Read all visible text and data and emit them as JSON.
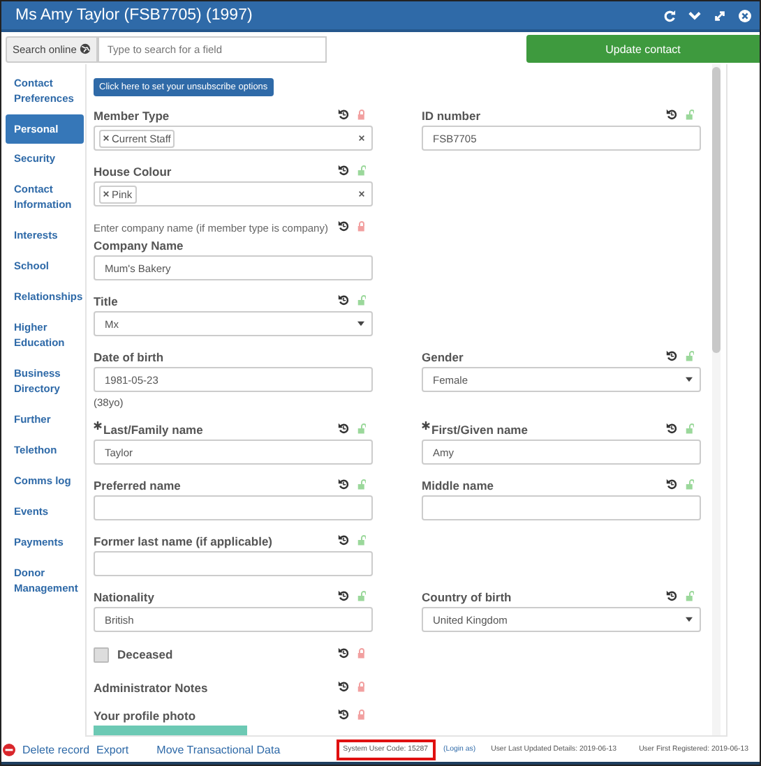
{
  "window": {
    "title": "Ms Amy Taylor (FSB7705) (1997)"
  },
  "toolbar": {
    "search_online": "Search online",
    "search_placeholder": "Type to search for a field",
    "update_button": "Update contact"
  },
  "sidebar": {
    "items": [
      {
        "label": "Contact Preferences",
        "selected": false
      },
      {
        "label": "Personal",
        "selected": true
      },
      {
        "label": "Security",
        "selected": false
      },
      {
        "label": "Contact Information",
        "selected": false
      },
      {
        "label": "Interests",
        "selected": false
      },
      {
        "label": "School",
        "selected": false
      },
      {
        "label": "Relationships",
        "selected": false
      },
      {
        "label": "Higher Education",
        "selected": false
      },
      {
        "label": "Business Directory",
        "selected": false
      },
      {
        "label": "Further",
        "selected": false
      },
      {
        "label": "Telethon",
        "selected": false
      },
      {
        "label": "Comms log",
        "selected": false
      },
      {
        "label": "Events",
        "selected": false
      },
      {
        "label": "Payments",
        "selected": false
      },
      {
        "label": "Donor Management",
        "selected": false
      }
    ]
  },
  "form": {
    "unsubscribe_button": "Click here to set your unsubscribe options",
    "rows": [
      {
        "left": {
          "kind": "tags",
          "label": "Member Type",
          "locked": true,
          "tags": [
            "Current Staff"
          ]
        },
        "right": {
          "kind": "text",
          "label": "ID number",
          "locked": false,
          "value": "FSB7705"
        }
      },
      {
        "left": {
          "kind": "tags",
          "label": "House Colour",
          "locked": false,
          "tags": [
            "Pink"
          ]
        }
      },
      {
        "left": {
          "kind": "text",
          "note": "Enter company name (if member type is company)",
          "note_locked": true,
          "label": "Company Name",
          "value": "Mum's Bakery"
        }
      },
      {
        "left": {
          "kind": "select",
          "label": "Title",
          "locked": false,
          "value": "Mx"
        }
      },
      {
        "left": {
          "kind": "text",
          "label": "Date of birth",
          "value": "1981-05-23",
          "hint": "(38yo)"
        },
        "right": {
          "kind": "select",
          "label": "Gender",
          "locked": false,
          "value": "Female"
        }
      },
      {
        "left": {
          "kind": "text",
          "label": "Last/Family name",
          "required": true,
          "locked": false,
          "value": "Taylor"
        },
        "right": {
          "kind": "text",
          "label": "First/Given name",
          "required": true,
          "locked": false,
          "value": "Amy"
        }
      },
      {
        "left": {
          "kind": "text",
          "label": "Preferred name",
          "locked": false
        },
        "right": {
          "kind": "text",
          "label": "Middle name",
          "locked": false
        }
      },
      {
        "left": {
          "kind": "text",
          "label": "Former last name (if applicable)",
          "locked": false
        }
      },
      {
        "left": {
          "kind": "text",
          "label": "Nationality",
          "locked": false,
          "value": "British"
        },
        "right": {
          "kind": "select",
          "label": "Country of birth",
          "locked": false,
          "value": "United Kingdom"
        }
      },
      {
        "left": {
          "kind": "checkbox",
          "label": "Deceased",
          "checked": false,
          "locked": true
        }
      },
      {
        "left": {
          "kind": "label",
          "label": "Administrator Notes",
          "locked": true
        }
      },
      {
        "left": {
          "label": "Your profile photo",
          "locked": true
        }
      }
    ]
  },
  "footer": {
    "links": [
      "Delete record",
      "Export",
      "Move Transactional Data"
    ],
    "info": [
      {
        "text": "System User Code: 15287",
        "kind": "text",
        "highlighted": true
      },
      {
        "text": "(Login as)",
        "kind": "link"
      },
      {
        "text": "User Last Updated Details: 2019-06-13",
        "kind": "text"
      },
      {
        "text": "User First Registered: 2019-06-13",
        "kind": "text"
      }
    ]
  }
}
